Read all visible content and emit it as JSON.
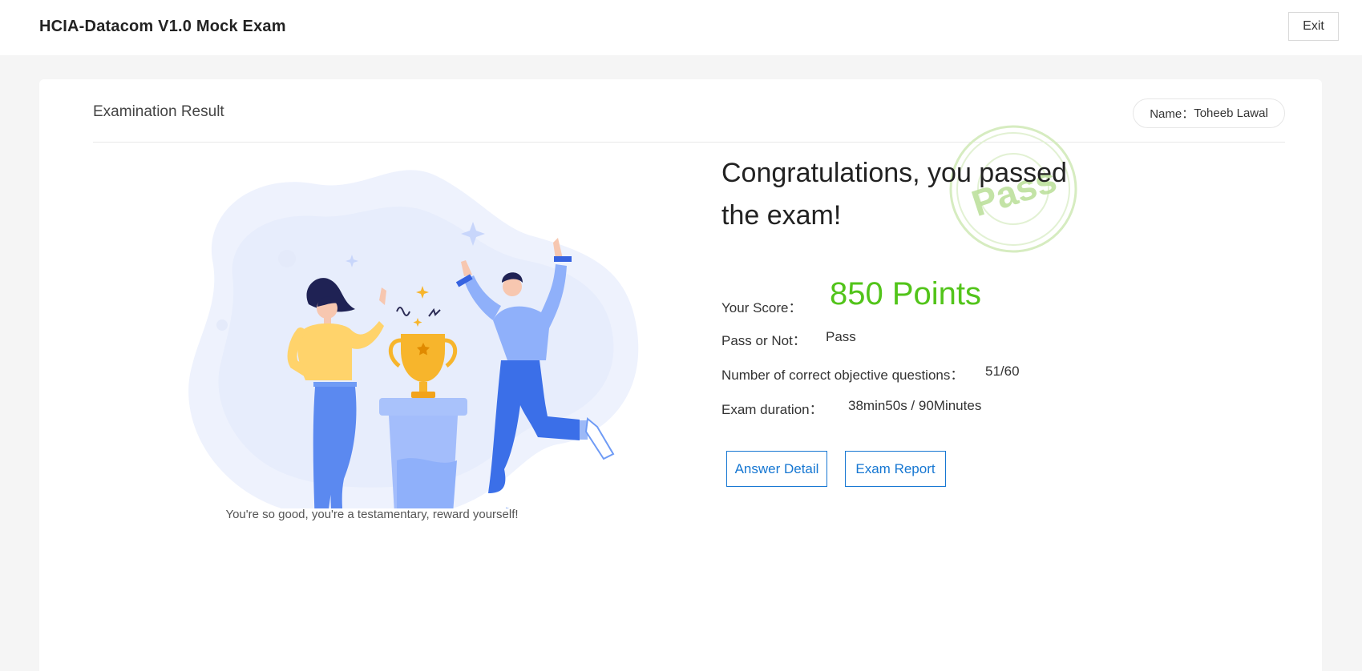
{
  "header": {
    "title": "HCIA-Datacom V1.0 Mock Exam",
    "exit_label": "Exit"
  },
  "result": {
    "title": "Examination Result",
    "name_label": "Name：",
    "name_value": "Toheeb Lawal",
    "congrats": "Congratulations, you passed the exam!",
    "stamp_text": "Pass",
    "score_label": "Your Score：",
    "score_value": "850 Points",
    "pass_label": "Pass or Not：",
    "pass_value": "Pass",
    "correct_label": "Number of correct objective questions：",
    "correct_value": "51/60",
    "duration_label": "Exam duration：",
    "duration_value": "38min50s / 90Minutes",
    "answer_detail_label": "Answer Detail",
    "exam_report_label": "Exam Report",
    "tagline": "You're so good, you're a testamentary, reward yourself!"
  },
  "colors": {
    "score_green": "#52c41a",
    "link_blue": "#1677d2",
    "stamp_green": "#9ed36a",
    "illustration_blue": "#6f9bf5",
    "illustration_yellow": "#ffd36b",
    "trophy_gold": "#f7b52c"
  }
}
